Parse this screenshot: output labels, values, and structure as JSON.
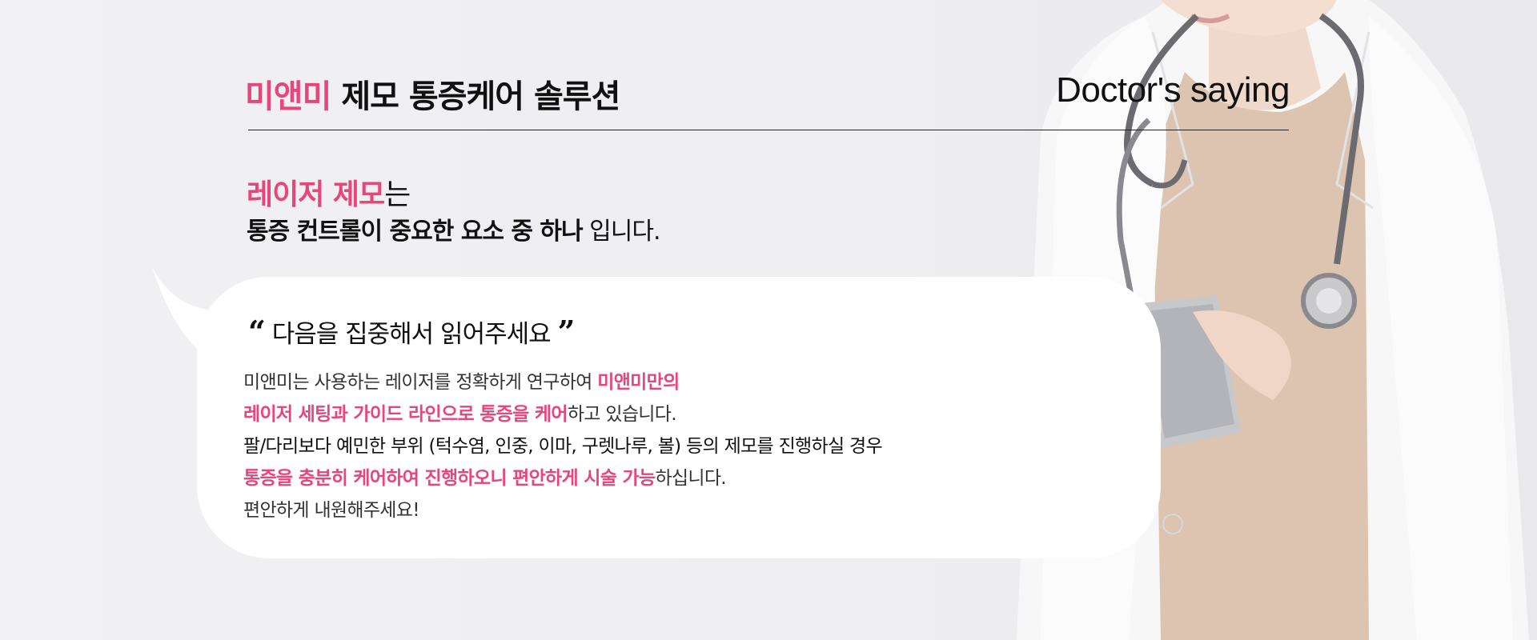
{
  "header": {
    "brand": "미앤미",
    "title_rest": " 제모 통증케어 솔루션",
    "subtitle": "Doctor's saying"
  },
  "headline": {
    "pink": "레이저 제모",
    "suffix": "는",
    "line2_bold": "통증 컨트롤이 중요한 요소 중 하나",
    "line2_rest": " 입니다."
  },
  "quote": {
    "open_mark": "“",
    "text": " 다음을 집중해서 읽어주세요 ",
    "close_mark": "”"
  },
  "body": {
    "line1_a": "미앤미는 사용하는 레이저를 정확하게 연구하여 ",
    "line1_b": "미앤미만의",
    "line2_a": "레이저 세팅과 가이드 라인으로 통증을 케어",
    "line2_b": "하고 있습니다.",
    "line3": "팔/다리보다 예민한 부위 (턱수염, 인중, 이마, 구렛나루, 볼) 등의 제모를 진행하실 경우",
    "line4_a": "통증을 충분히 케어하여 진행하오니 편안하게 시술 가능",
    "line4_b": "하십니다.",
    "line5": "편안하게 내원해주세요!"
  },
  "colors": {
    "accent": "#e8457b",
    "text": "#111111",
    "background": "#eeeef0"
  }
}
